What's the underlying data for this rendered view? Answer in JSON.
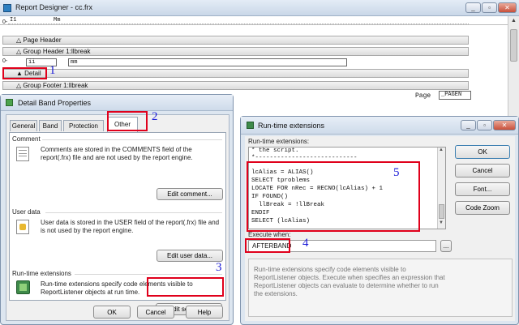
{
  "designer": {
    "title": "Report Designer - cc.frx",
    "ruler_labels": [
      "I1",
      "Mm"
    ],
    "bands": {
      "page_header": "Page Header",
      "group_header": "Group Header 1:llbreak",
      "detail": "Detail",
      "group_footer": "Group Footer 1:llbreak"
    },
    "detail_fields": [
      "ii",
      "mm"
    ],
    "footer_page_label": "Page",
    "footer_page_field": "_PAGEN"
  },
  "band_props": {
    "title": "Detail Band Properties",
    "tabs": [
      "General",
      "Band",
      "Protection",
      "Other"
    ],
    "active_tab": "Other",
    "comment": {
      "heading": "Comment",
      "text": "Comments are stored in the COMMENTS field of the report(.frx) file and are not used by the report engine.",
      "button": "Edit comment..."
    },
    "user_data": {
      "heading": "User data",
      "text": "User data is stored in the USER field of the report(.frx) file and is not used by the report engine.",
      "button": "Edit user data..."
    },
    "runtime": {
      "heading": "Run-time extensions",
      "text": "Run-time extensions specify code elements visible to ReportListener objects at run time.",
      "button": "Edit settings..."
    },
    "ok": "OK",
    "cancel": "Cancel",
    "help": "Help"
  },
  "rte": {
    "title": "Run-time extensions",
    "label": "Run-time extensions:",
    "code_top": [
      "* the script.",
      "*----------------------------"
    ],
    "code_lines": [
      "lcAlias = ALIAS()",
      "SELECT tproblems",
      "LOCATE FOR nRec = RECNO(lcAlias) + 1",
      "IF FOUND()",
      "  llBreak = !llBreak",
      "ENDIF",
      "SELECT (lcAlias)"
    ],
    "execute_label": "Execute when:",
    "execute_value": "AFTERBAND",
    "ellipsis": "...",
    "description": "Run-time extensions specify code elements visible to ReportListener objects. Execute when specifies an expression that ReportListener objects can evaluate to determine whether to run the extensions.",
    "ok": "OK",
    "cancel": "Cancel",
    "font": "Font...",
    "code_zoom": "Code Zoom"
  },
  "markers": [
    "1",
    "2",
    "3",
    "4",
    "5"
  ],
  "colors": {
    "highlight": "#e0001b",
    "marker": "#1b1bd8",
    "titlebar": "#cfdcea"
  }
}
